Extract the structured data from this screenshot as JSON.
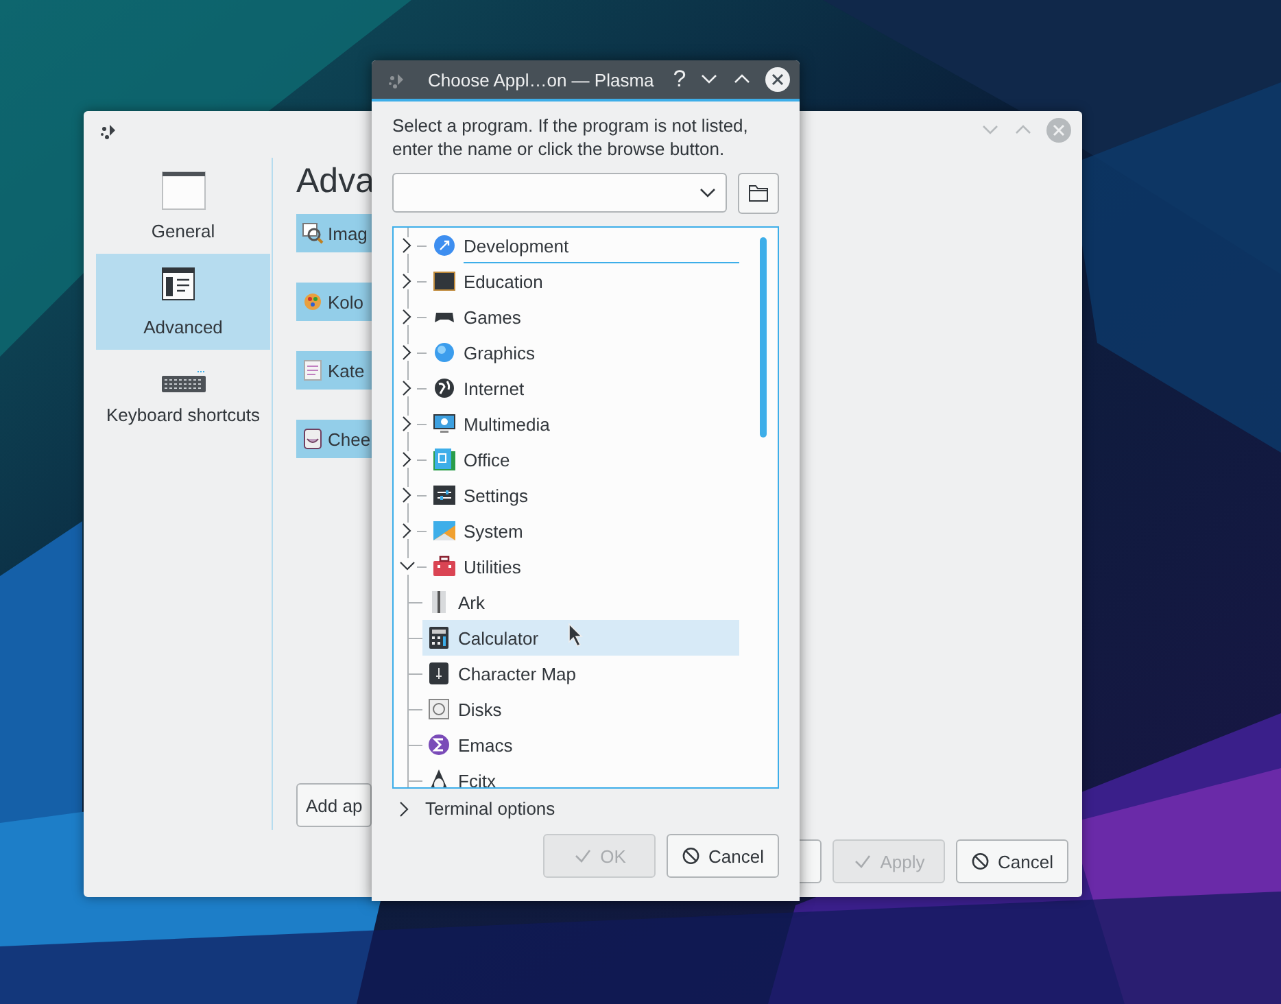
{
  "settings_window": {
    "sidebar": [
      {
        "label": "General",
        "selected": false
      },
      {
        "label": "Advanced",
        "selected": true
      },
      {
        "label": "Keyboard shortcuts",
        "selected": false
      }
    ],
    "heading": "Adva",
    "items": [
      "Imag",
      "Kolo",
      "Kate",
      "Chee"
    ],
    "add_button": "Add ap",
    "buttons": [
      {
        "kind": "plain",
        "disabled": false
      },
      {
        "kind": "apply",
        "label": "Apply",
        "disabled": true
      },
      {
        "kind": "cancel",
        "label": "Cancel",
        "disabled": false
      }
    ]
  },
  "dialog": {
    "title": "Choose Appl…on — Plasma",
    "help": "?",
    "instruction": "Select a program. If the program is not listed, enter the name or click the browse button.",
    "tree": [
      {
        "label": "Development",
        "expanded": false,
        "focused": true,
        "selected": false
      },
      {
        "label": "Education",
        "expanded": false,
        "focused": false,
        "selected": false
      },
      {
        "label": "Games",
        "expanded": false,
        "focused": false,
        "selected": false
      },
      {
        "label": "Graphics",
        "expanded": false,
        "focused": false,
        "selected": false
      },
      {
        "label": "Internet",
        "expanded": false,
        "focused": false,
        "selected": false
      },
      {
        "label": "Multimedia",
        "expanded": false,
        "focused": false,
        "selected": false
      },
      {
        "label": "Office",
        "expanded": false,
        "focused": false,
        "selected": false
      },
      {
        "label": "Settings",
        "expanded": false,
        "focused": false,
        "selected": false
      },
      {
        "label": "System",
        "expanded": false,
        "focused": false,
        "selected": false
      },
      {
        "label": "Utilities",
        "expanded": true,
        "focused": false,
        "selected": false,
        "children": [
          {
            "label": "Ark",
            "focused": false,
            "selected": false
          },
          {
            "label": "Calculator",
            "focused": false,
            "selected": true
          },
          {
            "label": "Character Map",
            "focused": false,
            "selected": false
          },
          {
            "label": "Disks",
            "focused": false,
            "selected": false
          },
          {
            "label": "Emacs",
            "focused": false,
            "selected": false
          },
          {
            "label": "Fcitx",
            "focused": false,
            "selected": false
          }
        ]
      }
    ],
    "terminal_options": {
      "label": "Terminal options",
      "expanded": false
    },
    "buttons": [
      {
        "kind": "ok",
        "label": "OK",
        "disabled": true
      },
      {
        "kind": "cancel",
        "label": "Cancel",
        "disabled": false
      }
    ]
  }
}
